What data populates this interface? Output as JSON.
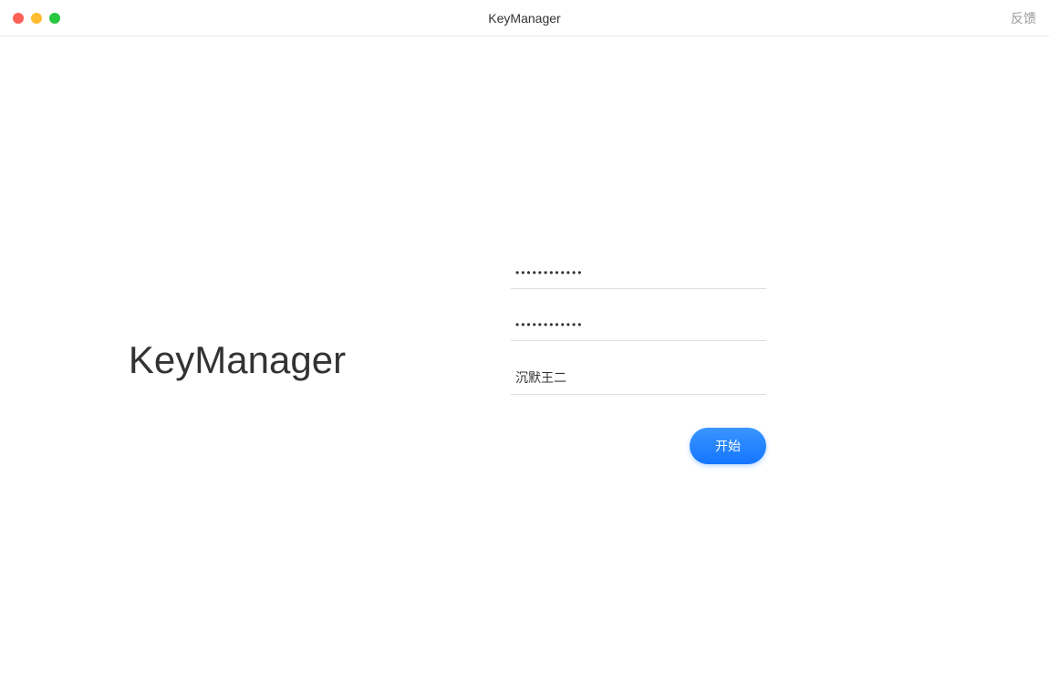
{
  "titlebar": {
    "title": "KeyManager",
    "feedback_label": "反馈"
  },
  "brand": {
    "name": "KeyManager"
  },
  "form": {
    "password1_value": "••••••••••••",
    "password2_value": "••••••••••••",
    "username_value": "沉默王二",
    "start_button_label": "开始"
  }
}
